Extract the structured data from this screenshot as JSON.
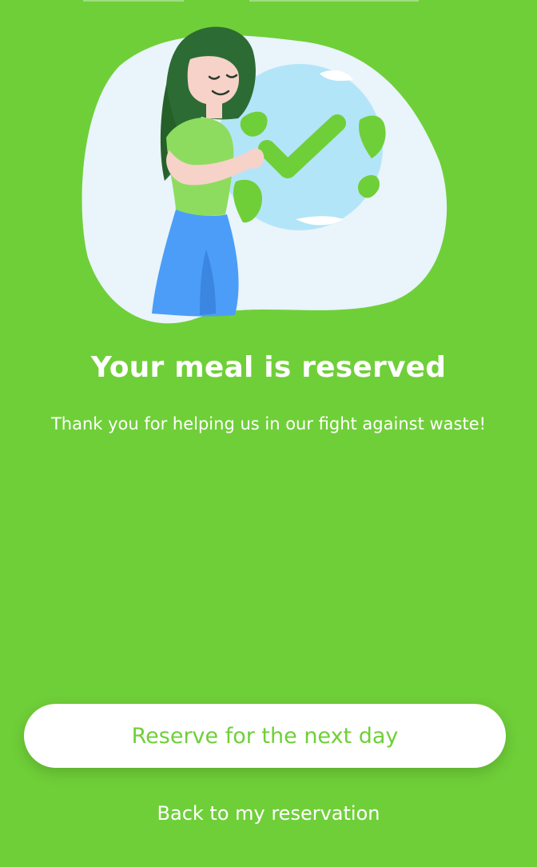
{
  "illustration": {
    "icon": "woman-hugging-globe-checkmark-icon"
  },
  "confirmation": {
    "title": "Your meal is reserved",
    "message": "Thank you for helping us in our fight against waste!"
  },
  "actions": {
    "primary_label": "Reserve for the next day",
    "secondary_label": "Back to my reservation"
  },
  "colors": {
    "background": "#6fcf38",
    "accent": "#6fcf38",
    "text": "#ffffff",
    "button_background": "#ffffff"
  }
}
